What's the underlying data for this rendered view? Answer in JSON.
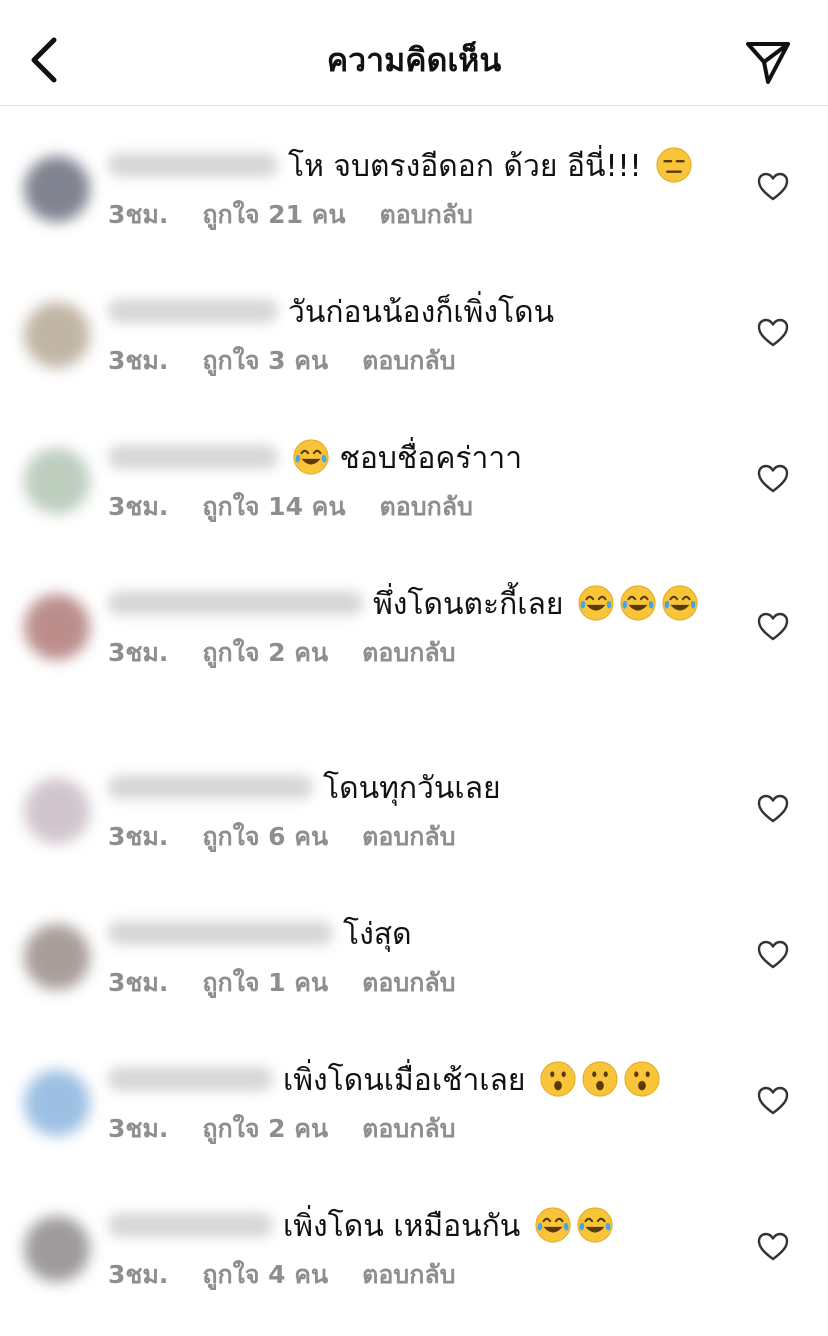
{
  "header": {
    "title": "ความคิดเห็น"
  },
  "icons": {
    "back": "chevron-left-icon",
    "send": "paper-plane-icon",
    "like": "heart-outline-icon"
  },
  "colors": {
    "meta_text": "#8e8e8e",
    "divider": "#e4e4e4",
    "emoji_face": "#f8c43a"
  },
  "comments": [
    {
      "text": "โห จบตรงอีดอก ด้วย อีนี่!!!",
      "emojis": [
        "expressionless"
      ],
      "time": "3ชม.",
      "likes": "ถูกใจ 21 คน",
      "reply": "ตอบกลับ"
    },
    {
      "text": "วันก่อนน้องก็เพิ่งโดน",
      "emojis": [],
      "time": "3ชม.",
      "likes": "ถูกใจ 3 คน",
      "reply": "ตอบกลับ"
    },
    {
      "text": "ชอบชื่อคร่าาา",
      "emojis_before": [
        "joy"
      ],
      "emojis": [],
      "time": "3ชม.",
      "likes": "ถูกใจ 14 คน",
      "reply": "ตอบกลับ"
    },
    {
      "text": "พึ่งโดนตะกี้เลย",
      "emojis": [
        "joy",
        "joy",
        "joy"
      ],
      "time": "3ชม.",
      "likes": "ถูกใจ 2 คน",
      "reply": "ตอบกลับ"
    },
    {
      "text": "โดนทุกวันเลย",
      "emojis": [],
      "time": "3ชม.",
      "likes": "ถูกใจ 6 คน",
      "reply": "ตอบกลับ"
    },
    {
      "text": "โง่สุด",
      "emojis": [],
      "time": "3ชม.",
      "likes": "ถูกใจ 1 คน",
      "reply": "ตอบกลับ"
    },
    {
      "text": "เพิ่งโดนเมื่อเช้าเลย",
      "emojis": [
        "hushed",
        "hushed",
        "hushed"
      ],
      "time": "3ชม.",
      "likes": "ถูกใจ 2 คน",
      "reply": "ตอบกลับ"
    },
    {
      "text": "เพิ่งโดน เหมือนกัน",
      "emojis": [
        "joy",
        "joy"
      ],
      "time": "3ชม.",
      "likes": "ถูกใจ 4 คน",
      "reply": "ตอบกลับ"
    }
  ]
}
